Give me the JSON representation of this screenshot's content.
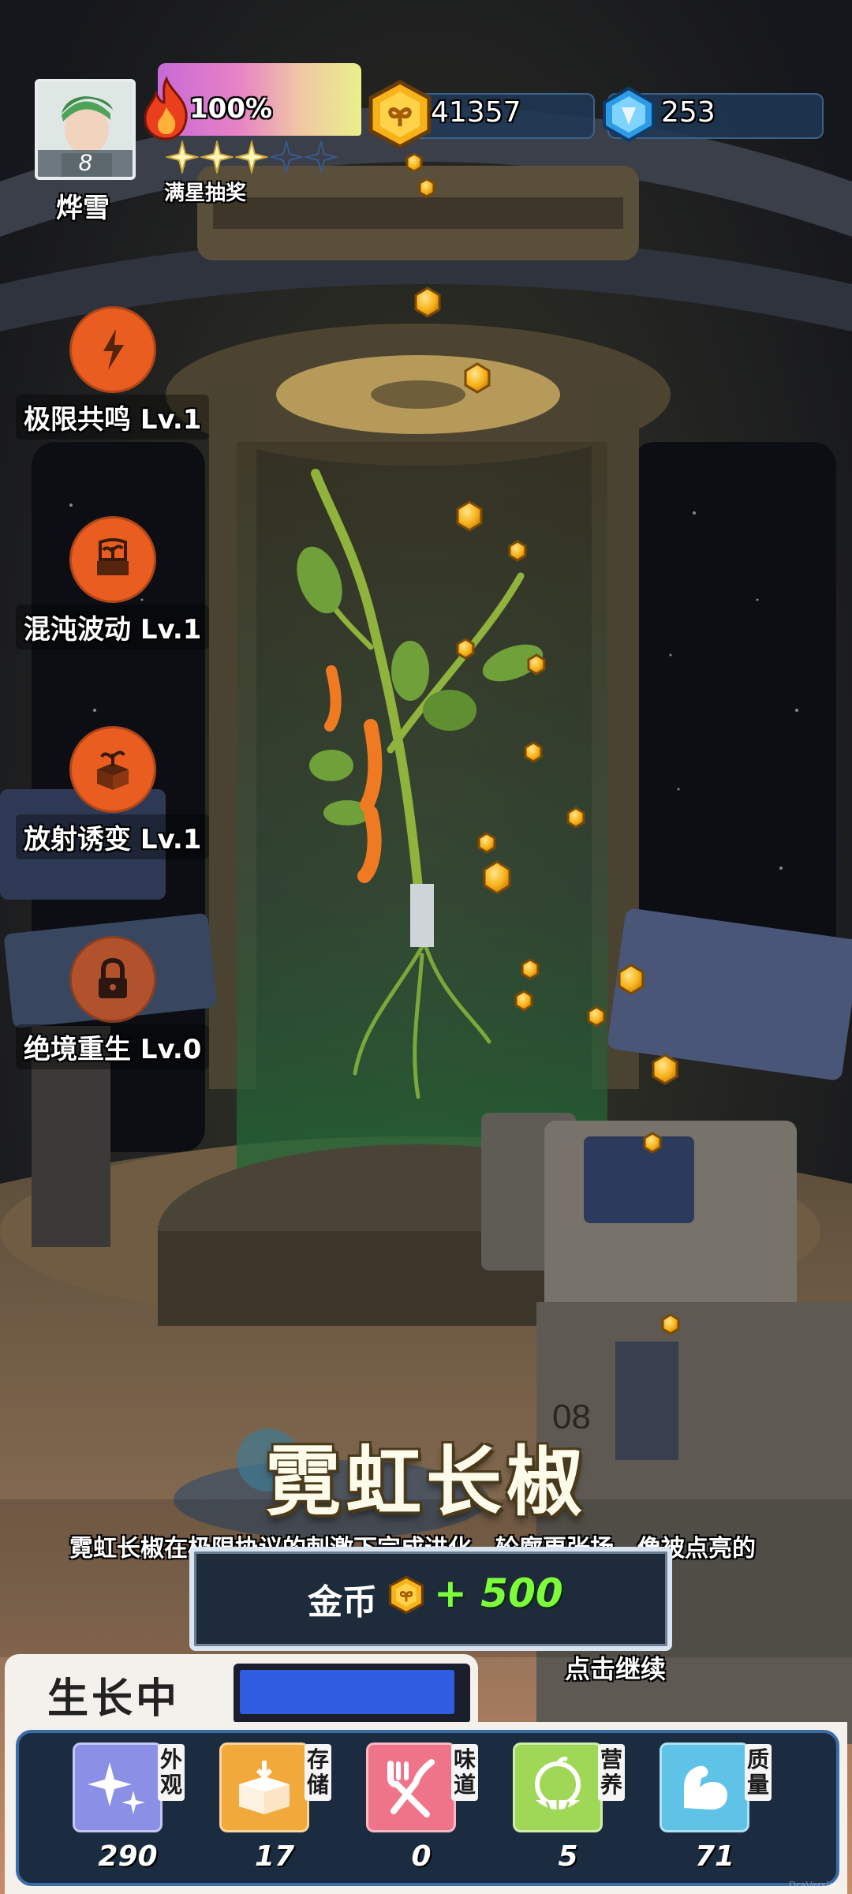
{
  "player": {
    "name": "烨雪",
    "level": "8"
  },
  "fire": {
    "percent": "100%",
    "progress": 1.0
  },
  "stars": {
    "filled": 3,
    "total": 5,
    "label": "满星抽奖"
  },
  "currency": {
    "gold": "41357",
    "gems": "253"
  },
  "skills": [
    {
      "name": "极限共鸣 Lv.1",
      "icon": "lightning-sprout-icon",
      "locked": false
    },
    {
      "name": "混沌波动 Lv.1",
      "icon": "potted-plant-icon",
      "locked": false
    },
    {
      "name": "放射诱变 Lv.1",
      "icon": "plant-box-icon",
      "locked": false
    },
    {
      "name": "绝境重生 Lv.0",
      "icon": "padlock-icon",
      "locked": true
    }
  ],
  "plant": {
    "title": "霓虹长椒",
    "description": "霓虹长椒在极限协议的刺激下完成进化，轮廓更张扬，像被点亮的"
  },
  "reward": {
    "label": "金币",
    "amount": "+ 500"
  },
  "continue_hint": "点击继续",
  "growth": {
    "label": "生长中",
    "progress": 0.98
  },
  "stats": [
    {
      "tag": "外观",
      "value": "290",
      "icon": "sparkle-icon",
      "color": "#8b8fe6"
    },
    {
      "tag": "存储",
      "value": "17",
      "icon": "box-icon",
      "color": "#f2a93b"
    },
    {
      "tag": "味道",
      "value": "0",
      "icon": "fork-knife-icon",
      "color": "#f07489"
    },
    {
      "tag": "营养",
      "value": "5",
      "icon": "citrus-icon",
      "color": "#9fd856"
    },
    {
      "tag": "质量",
      "value": "71",
      "icon": "muscle-arm-icon",
      "color": "#5fc3e8"
    }
  ],
  "colors": {
    "accent_orange": "#ea5d20",
    "reward_green": "#7dfc3c",
    "growth_blue": "#2f5ce0",
    "panel_border": "#3c6ca8"
  },
  "watermark": "DraVersion"
}
